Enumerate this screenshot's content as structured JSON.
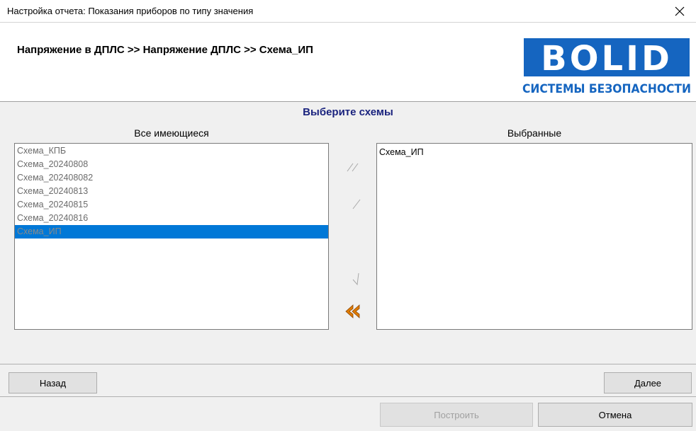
{
  "window": {
    "title": "Настройка отчета: Показания приборов по типу значения",
    "close_icon": "close-icon"
  },
  "header": {
    "breadcrumb": "Напряжение в ДПЛС >> Напряжение ДПЛС >> Схема_ИП",
    "logo": {
      "word": "BOLID",
      "tagline": "СИСТЕМЫ БЕЗОПАСНОСТИ",
      "brand_color": "#1565c0"
    }
  },
  "main": {
    "section_title": "Выберите схемы",
    "available_label": "Все имеющиеся",
    "selected_label": "Выбранные",
    "available_items": [
      "Схема_КПБ",
      "Схема_20240808",
      "Схема_202408082",
      "Схема_20240813",
      "Схема_20240815",
      "Схема_20240816",
      "Схема_ИП"
    ],
    "available_selected_index": 6,
    "selected_items": [
      "Схема_ИП"
    ],
    "move_buttons": [
      {
        "icon": "move-all-right-icon",
        "enabled": false
      },
      {
        "icon": "move-right-icon",
        "enabled": false
      },
      {
        "icon": "move-left-icon",
        "enabled": false
      },
      {
        "icon": "move-all-left-icon",
        "enabled": true
      }
    ],
    "accent_color": "#0078d7",
    "active_arrow_color": "#e07b00"
  },
  "navigation": {
    "back_label": "Назад",
    "next_label": "Далее"
  },
  "footer": {
    "build_label": "Построить",
    "build_enabled": false,
    "cancel_label": "Отмена"
  }
}
